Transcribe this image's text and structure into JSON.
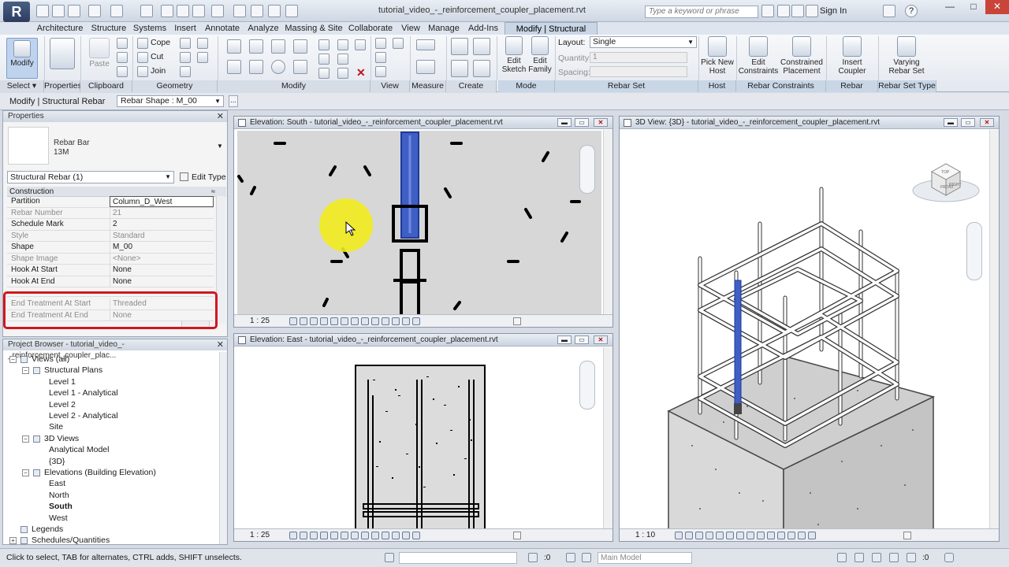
{
  "titlebar": {
    "app_letter": "R",
    "title": "tutorial_video_-_reinforcement_coupler_placement.rvt",
    "search_placeholder": "Type a keyword or phrase",
    "sign_in": "Sign In",
    "minimize": "—",
    "maximize": "□",
    "close": "✕",
    "help": "?"
  },
  "ribbon_tabs": [
    "Architecture",
    "Structure",
    "Systems",
    "Insert",
    "Annotate",
    "Analyze",
    "Massing & Site",
    "Collaborate",
    "View",
    "Manage",
    "Add-Ins",
    "Modify | Structural Rebar"
  ],
  "ribbon": {
    "select": {
      "modify": "Modify",
      "label": "Select"
    },
    "properties": {
      "label": "Properties"
    },
    "clipboard": {
      "paste": "Paste",
      "label": "Clipboard"
    },
    "geometry": {
      "cope": "Cope",
      "cut": "Cut",
      "join": "Join",
      "label": "Geometry"
    },
    "modify_label": "Modify",
    "view_label": "View",
    "measure_label": "Measure",
    "create_label": "Create",
    "mode": {
      "edit_sketch": [
        "Edit",
        "Sketch"
      ],
      "edit_family": [
        "Edit",
        "Family"
      ],
      "label": "Mode"
    },
    "rebar_set": {
      "layout_label": "Layout:",
      "layout_value": "Single",
      "quantity_label": "Quantity:",
      "quantity_value": "1",
      "spacing_label": "Spacing:",
      "label": "Rebar Set"
    },
    "host": {
      "pick_new_host": [
        "Pick New",
        "Host"
      ],
      "label": "Host"
    },
    "rebar_constraints": {
      "edit_constraints": [
        "Edit",
        "Constraints"
      ],
      "constrained_placement": [
        "Constrained",
        "Placement"
      ],
      "label": "Rebar Constraints"
    },
    "rebar_coupler": {
      "insert_coupler": [
        "Insert",
        "Coupler"
      ],
      "label": "Rebar Coupler"
    },
    "rebar_set_type": {
      "varying": [
        "Varying",
        "Rebar Set"
      ],
      "label": "Rebar Set Type"
    }
  },
  "options_bar": {
    "context": "Modify | Structural Rebar",
    "rebar_shape": "Rebar Shape : M_00",
    "more": "..."
  },
  "properties": {
    "title": "Properties",
    "type_name": [
      "Rebar Bar",
      "13M"
    ],
    "filter": "Structural Rebar (1)",
    "edit_type": "Edit Type",
    "group": "Construction",
    "rows": [
      {
        "k": "Partition",
        "v": "Column_D_West"
      },
      {
        "k": "Rebar Number",
        "v": "21"
      },
      {
        "k": "Schedule Mark",
        "v": "2"
      },
      {
        "k": "Style",
        "v": "Standard"
      },
      {
        "k": "Shape",
        "v": "M_00"
      },
      {
        "k": "Shape Image",
        "v": "<None>"
      },
      {
        "k": "Hook At Start",
        "v": "None"
      },
      {
        "k": "Hook At End",
        "v": "None"
      },
      {
        "k": "End Treatment At Start",
        "v": "Threaded"
      },
      {
        "k": "End Treatment At End",
        "v": "None"
      }
    ]
  },
  "project_browser": {
    "title": "Project Browser - tutorial_video_-_reinforcement_coupler_plac...",
    "nodes": [
      {
        "label": "Views (all)",
        "level": 0,
        "tw": "−"
      },
      {
        "label": "Structural Plans",
        "level": 1,
        "tw": "−"
      },
      {
        "label": "Level 1",
        "level": 2
      },
      {
        "label": "Level 1 - Analytical",
        "level": 2
      },
      {
        "label": "Level 2",
        "level": 2
      },
      {
        "label": "Level 2 - Analytical",
        "level": 2
      },
      {
        "label": "Site",
        "level": 2
      },
      {
        "label": "3D Views",
        "level": 1,
        "tw": "−"
      },
      {
        "label": "Analytical Model",
        "level": 2
      },
      {
        "label": "{3D}",
        "level": 2
      },
      {
        "label": "Elevations (Building Elevation)",
        "level": 1,
        "tw": "−"
      },
      {
        "label": "East",
        "level": 2
      },
      {
        "label": "North",
        "level": 2
      },
      {
        "label": "South",
        "level": 2,
        "bold": true
      },
      {
        "label": "West",
        "level": 2
      },
      {
        "label": "Legends",
        "level": 0
      },
      {
        "label": "Schedules/Quantities",
        "level": 0,
        "tw": "+"
      }
    ]
  },
  "views": {
    "south": {
      "title": "Elevation: South - tutorial_video_-_reinforcement_coupler_placement.rvt",
      "scale": "1 : 25"
    },
    "east": {
      "title": "Elevation: East - tutorial_video_-_reinforcement_coupler_placement.rvt",
      "scale": "1 : 25"
    },
    "threeD": {
      "title": "3D View: {3D} - tutorial_video_-_reinforcement_coupler_placement.rvt",
      "scale": "1 : 10",
      "cube_front": "FRONT",
      "cube_right": "RIGHT",
      "cube_top": "TOP"
    }
  },
  "statusbar": {
    "text": "Click to select, TAB for alternates, CTRL adds, SHIFT unselects.",
    "selection": ":0",
    "model": "Main Model"
  },
  "colors": {
    "accent_blue": "#3f5fc4",
    "highlight_red": "#d2161e",
    "cursor_highlight": "#f2ec1e"
  }
}
